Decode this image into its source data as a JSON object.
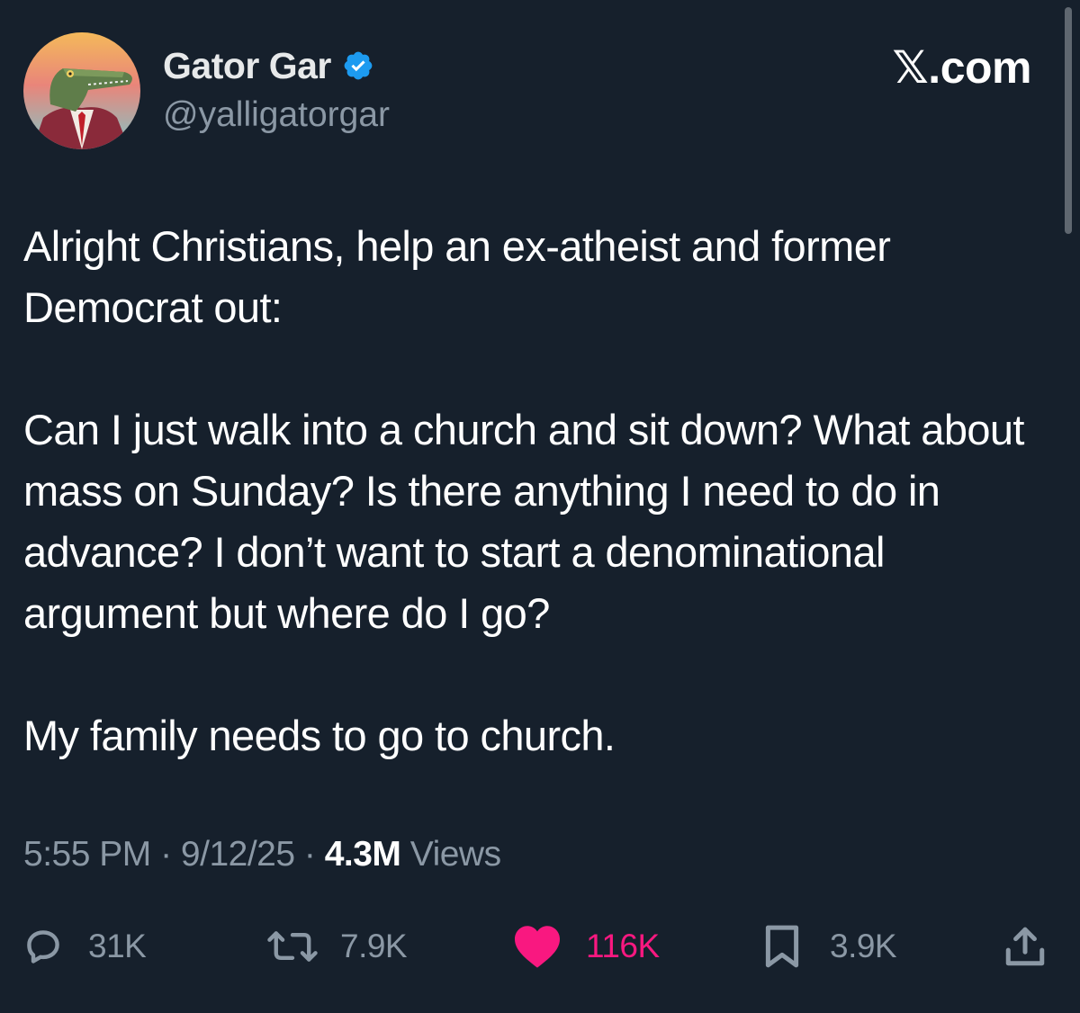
{
  "author": {
    "display_name": "Gator Gar",
    "handle": "@yalligatorgar",
    "verified": true,
    "avatar_icon": "alligator-in-suit-avatar"
  },
  "brand": "𝕏.com",
  "tweet": {
    "paragraphs": [
      "Alright Christians, help an ex-atheist and former Democrat out:",
      "Can I just walk into a church and sit down? What about mass on Sunday? Is there anything I need to do in advance? I don’t want to start a denominational argument but where do I go?",
      "My family needs to go to church."
    ]
  },
  "meta": {
    "time": "5:55 PM",
    "separator": " · ",
    "date": "9/12/25",
    "views_count": "4.3M",
    "views_label": " Views"
  },
  "actions": {
    "replies": "31K",
    "reposts": "7.9K",
    "likes": "116K",
    "bookmarks": "3.9K"
  },
  "colors": {
    "background": "#16202c",
    "secondary_text": "#8b98a5",
    "verified": "#1d9bf0",
    "like": "#f91880"
  }
}
